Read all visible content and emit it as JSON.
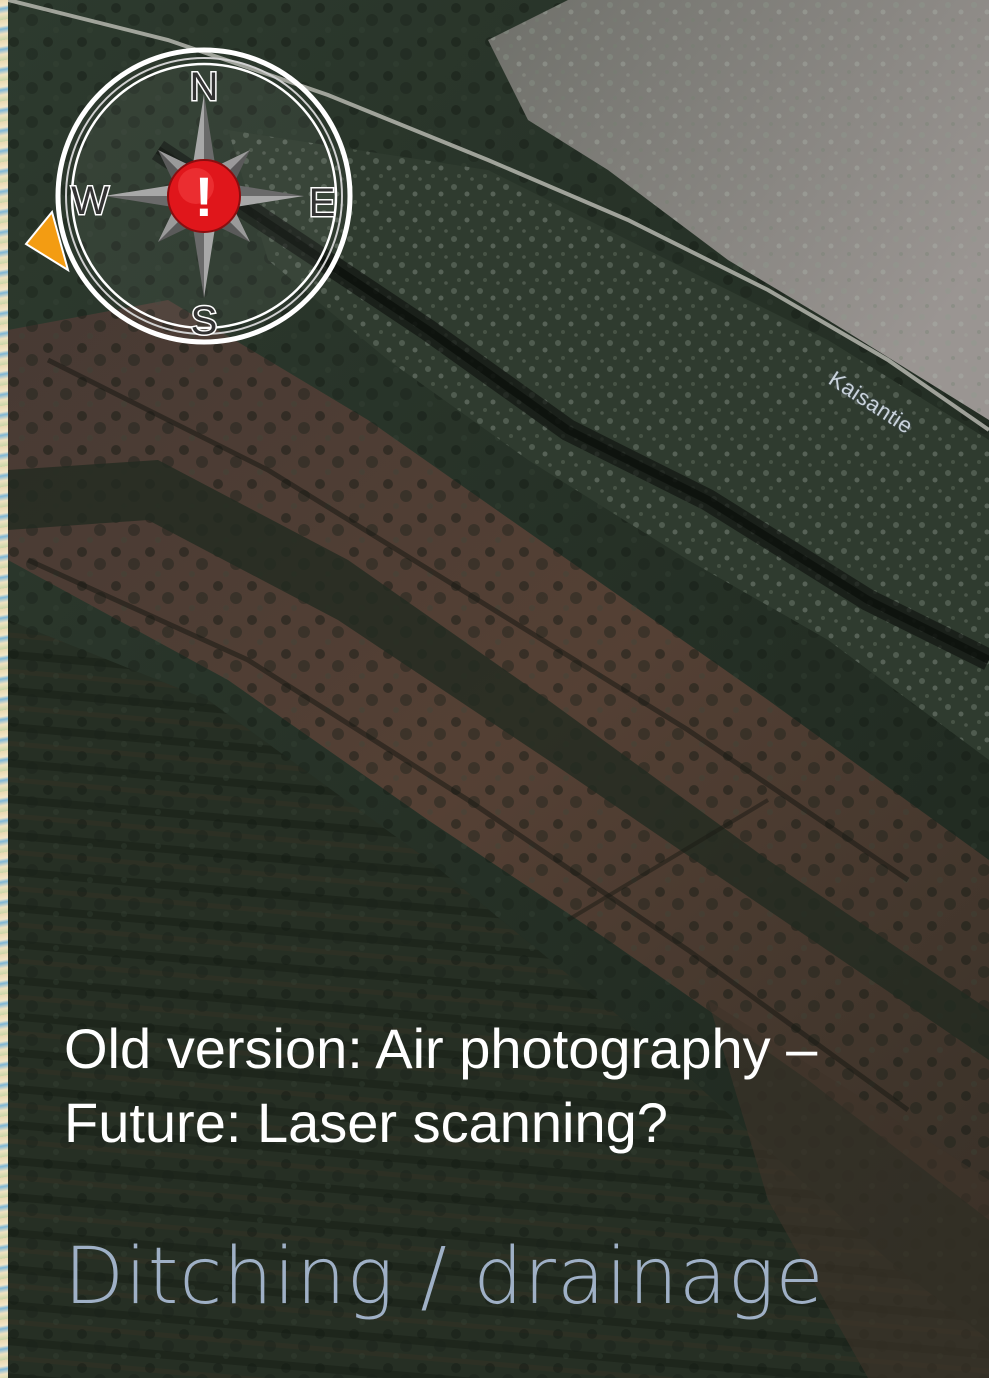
{
  "map": {
    "road_label": "Kaisantie"
  },
  "compass": {
    "north": "N",
    "south": "S",
    "east": "E",
    "west": "W",
    "alert_symbol": "!"
  },
  "caption": {
    "line1": "Old version: Air photography –",
    "line2": "Future: Laser scanning?"
  },
  "title": "Ditching / drainage",
  "colors": {
    "title": "#9fb0c6",
    "caption": "#ffffff",
    "alert": "#e0161b",
    "marker": "#f39c12"
  },
  "icons": [
    "compass-rose-icon",
    "alert-icon",
    "direction-marker-icon"
  ]
}
